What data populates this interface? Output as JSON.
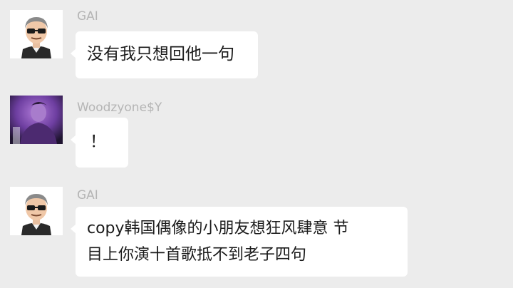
{
  "messages": [
    {
      "sender": "GAI",
      "avatar_icon": "cartoon-man-sunglasses-avatar",
      "text": "没有我只想回他一句"
    },
    {
      "sender": "Woodzyone$Y",
      "avatar_icon": "purple-photo-avatar",
      "text": "！"
    },
    {
      "sender": "GAI",
      "avatar_icon": "cartoon-man-sunglasses-avatar",
      "text_line1": "copy韩国偶像的小朋友想狂风肆意 节",
      "text_line2": "目上你演十首歌抵不到老子四句"
    }
  ],
  "colors": {
    "background": "#ececec",
    "bubble": "#ffffff",
    "sender_name": "#b5b5b5",
    "text": "#1b1b1b"
  }
}
